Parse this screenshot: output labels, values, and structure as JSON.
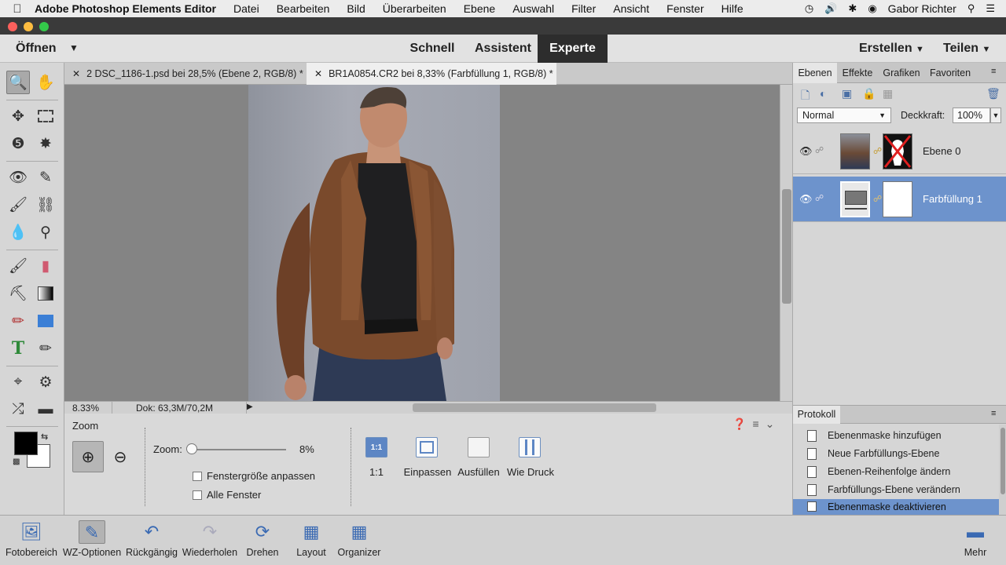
{
  "menubar": {
    "app_name": "Adobe Photoshop Elements Editor",
    "items": [
      "Datei",
      "Bearbeiten",
      "Bild",
      "Überarbeiten",
      "Ebene",
      "Auswahl",
      "Filter",
      "Ansicht",
      "Fenster",
      "Hilfe"
    ],
    "user": "Gabor Richter"
  },
  "modebar": {
    "open_label": "Öffnen",
    "modes": [
      "Schnell",
      "Assistent",
      "Experte"
    ],
    "active_mode": "Experte",
    "create_label": "Erstellen",
    "share_label": "Teilen"
  },
  "documents": {
    "tabs": [
      "2 DSC_1186-1.psd bei 28,5% (Ebene 2, RGB/8) *",
      "BR1A0854.CR2 bei 8,33% (Farbfüllung 1, RGB/8) *"
    ],
    "active_tab": 1
  },
  "status": {
    "zoom": "8.33%",
    "doc": "Dok: 63,3M/70,2M"
  },
  "tool_options": {
    "title": "Zoom",
    "zoom_label": "Zoom:",
    "zoom_value": "8%",
    "checkbox_fit_window": "Fenstergröße anpassen",
    "checkbox_all_windows": "Alle Fenster",
    "buttons": [
      {
        "icon_text": "1:1",
        "label": "1:1"
      },
      {
        "icon_text": "",
        "label": "Einpassen"
      },
      {
        "icon_text": "",
        "label": "Ausfüllen"
      },
      {
        "icon_text": "",
        "label": "Wie Druck"
      }
    ]
  },
  "layers_panel": {
    "tabs": [
      "Ebenen",
      "Effekte",
      "Grafiken",
      "Favoriten"
    ],
    "active_tab": "Ebenen",
    "blend_mode": "Normal",
    "opacity_label": "Deckkraft:",
    "opacity_value": "100%",
    "layers": [
      {
        "name": "Ebene 0",
        "selected": false
      },
      {
        "name": "Farbfüllung 1",
        "selected": true
      }
    ]
  },
  "history_panel": {
    "title": "Protokoll",
    "items": [
      "Ebenenmaske hinzufügen",
      "Neue Farbfüllungs-Ebene",
      "Ebenen-Reihenfolge ändern",
      "Farbfüllungs-Ebene verändern",
      "Ebenenmaske deaktivieren"
    ],
    "selected_index": 4
  },
  "taskbar": {
    "items": [
      "Fotobereich",
      "WZ-Optionen",
      "Rückgängig",
      "Wiederholen",
      "Drehen",
      "Layout",
      "Organizer"
    ],
    "more": "Mehr"
  },
  "colors": {
    "accent": "#6d93cc",
    "foreground": "#000000",
    "background": "#ffffff"
  }
}
